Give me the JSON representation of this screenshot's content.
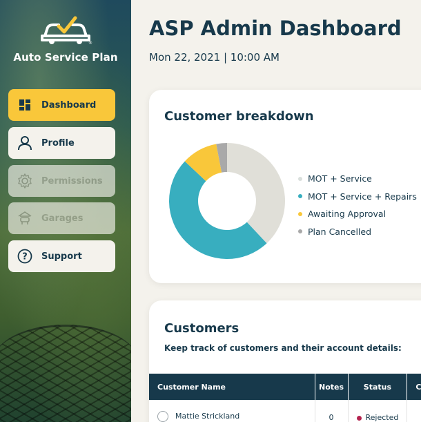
{
  "brand": {
    "name": "Auto Service Plan"
  },
  "sidebar": {
    "items": [
      {
        "label": "Dashboard",
        "icon": "dashboard-icon",
        "state": "active"
      },
      {
        "label": "Profile",
        "icon": "user-icon",
        "state": "normal"
      },
      {
        "label": "Permissions",
        "icon": "gear-icon",
        "state": "disabled"
      },
      {
        "label": "Garages",
        "icon": "garage-icon",
        "state": "disabled"
      },
      {
        "label": "Support",
        "icon": "help-icon",
        "state": "normal"
      }
    ]
  },
  "header": {
    "title": "ASP Admin Dashboard",
    "datetime": "Mon 22, 2021 | 10:00 AM"
  },
  "breakdown": {
    "title": "Customer breakdown",
    "legend": [
      {
        "label": "MOT + Service",
        "color": "#d9dfdc"
      },
      {
        "label": "MOT + Service + Repairs",
        "color": "#38aebf"
      },
      {
        "label": "Awaiting Approval",
        "color": "#f9c73a"
      },
      {
        "label": "Plan Cancelled",
        "color": "#a9a9a9"
      }
    ]
  },
  "chart_data": {
    "type": "pie",
    "categories": [
      "MOT + Service",
      "MOT + Service + Repairs",
      "Awaiting Approval",
      "Plan Cancelled"
    ],
    "values": [
      38,
      49,
      10,
      3
    ],
    "colors": [
      "#e0dfd8",
      "#38aebf",
      "#f9c73a",
      "#a9a9a9"
    ]
  },
  "customers": {
    "title": "Customers",
    "subtitle": "Keep track of customers and their account details:",
    "columns": [
      "Customer Name",
      "Notes",
      "Status",
      "Ch"
    ],
    "rows": [
      {
        "name": "Mattie Strickland",
        "notes": "0",
        "status": "Rejected",
        "status_color": "#b4234f"
      }
    ]
  },
  "colors": {
    "navy": "#17394b",
    "accent": "#f9c73a",
    "background": "#f4f2ec"
  }
}
